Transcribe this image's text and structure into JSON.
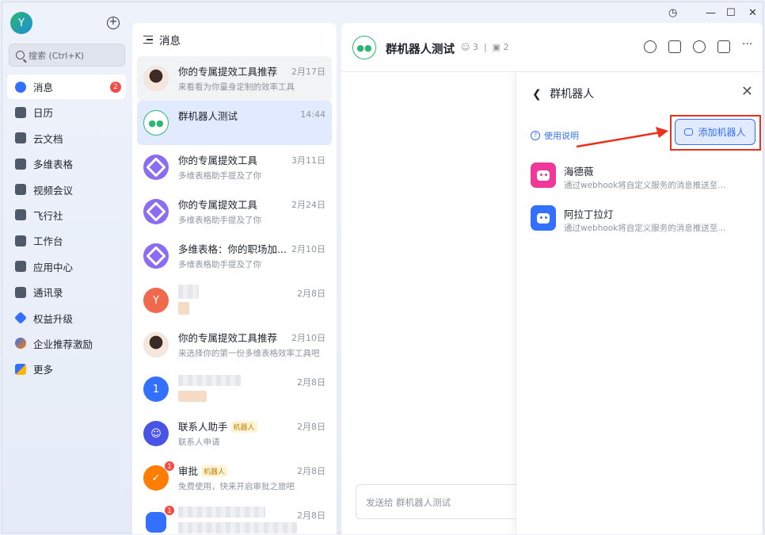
{
  "user": {
    "avatar_initial": "Y"
  },
  "window_controls": {
    "history": "◷",
    "minimize": "—",
    "maximize": "☐",
    "close": "✕"
  },
  "sidebar": {
    "new_label": "+",
    "search_placeholder": "搜索 (Ctrl+K)",
    "items": [
      {
        "label": "消息",
        "icon": "message-icon",
        "badge": "2"
      },
      {
        "label": "日历",
        "icon": "calendar-icon"
      },
      {
        "label": "云文档",
        "icon": "doc-icon"
      },
      {
        "label": "多维表格",
        "icon": "table-icon"
      },
      {
        "label": "视频会议",
        "icon": "video-icon"
      },
      {
        "label": "飞行社",
        "icon": "flag-icon"
      },
      {
        "label": "工作台",
        "icon": "grid-icon"
      },
      {
        "label": "应用中心",
        "icon": "bag-icon"
      },
      {
        "label": "通讯录",
        "icon": "contacts-icon"
      },
      {
        "label": "权益升级",
        "icon": "diamond-icon"
      },
      {
        "label": "企业推荐激励",
        "icon": "referral-icon"
      },
      {
        "label": "更多",
        "icon": "more-icon"
      }
    ]
  },
  "message_list": {
    "title": "消息",
    "chats": [
      {
        "title": "你的专属提效工具推荐",
        "date": "2月17日",
        "sub": "来看看为你量身定制的效率工具"
      },
      {
        "title": "群机器人测试",
        "date": "14:44",
        "sub": ""
      },
      {
        "title": "你的专属提效工具",
        "date": "3月11日",
        "sub": "多维表格助手提及了你"
      },
      {
        "title": "你的专属提效工具",
        "date": "2月24日",
        "sub": "多维表格助手提及了你"
      },
      {
        "title": "多维表格：你的职场加...",
        "date": "2月10日",
        "sub": "多维表格助手提及了你"
      },
      {
        "title": "",
        "date": "2月8日",
        "sub": "",
        "avatar": "Y"
      },
      {
        "title": "你的专属提效工具推荐",
        "date": "2月10日",
        "sub": "来选择你的第一份多维表格效率工具吧"
      },
      {
        "title": "",
        "date": "2月8日",
        "sub": "",
        "avatar": "1"
      },
      {
        "title": "联系人助手",
        "tag": "机器人",
        "date": "2月8日",
        "sub": "联系人申请"
      },
      {
        "title": "审批",
        "tag": "机器人",
        "date": "2月8日",
        "sub": "免费使用，快来开启审批之旅吧",
        "badge": "1"
      },
      {
        "title": "",
        "date": "2月8日",
        "sub": "",
        "badge": "1"
      }
    ]
  },
  "chat": {
    "group_name": "群机器人测试",
    "member_count": "3",
    "bot_count": "2",
    "input_placeholder": "发送给 群机器人测试"
  },
  "robot_drawer": {
    "title": "群机器人",
    "help_label": "使用说明",
    "add_button_label": "添加机器人",
    "robots": [
      {
        "name": "海德薇",
        "desc": "通过webhook将自定义服务的消息推送至...",
        "color": "#f0389a"
      },
      {
        "name": "阿拉丁拉灯",
        "desc": "通过webhook将自定义服务的消息推送至...",
        "color": "#3370ff"
      }
    ]
  },
  "colors": {
    "accent": "#3370ff",
    "highlight_red": "#e8321e",
    "badge_red": "#f54a45"
  }
}
